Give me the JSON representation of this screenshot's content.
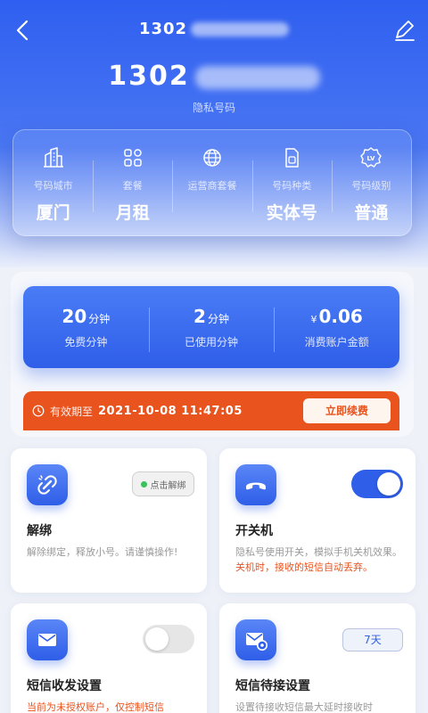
{
  "header": {
    "title_prefix": "1302",
    "number_prefix": "1302",
    "private_label": "隐私号码"
  },
  "info": [
    {
      "icon": "city-buildings-icon",
      "label": "号码城市",
      "value": "厦门"
    },
    {
      "icon": "grid-apps-icon",
      "label": "套餐",
      "value": "月租"
    },
    {
      "icon": "globe-icon",
      "label": "运营商套餐",
      "value": ""
    },
    {
      "icon": "sim-card-icon",
      "label": "号码种类",
      "value": "实体号"
    },
    {
      "icon": "level-badge-icon",
      "label": "号码级别",
      "value": "普通"
    }
  ],
  "usage": [
    {
      "value": "20",
      "unit": "分钟",
      "label": "免费分钟"
    },
    {
      "value": "2",
      "unit": "分钟",
      "label": "已使用分钟"
    },
    {
      "currency": "¥",
      "value": "0.06",
      "label": "消费账户金额"
    }
  ],
  "expire": {
    "label": "有效期至",
    "date": "2021-10-08 11:47:05",
    "renew_label": "立即续费"
  },
  "cards": {
    "unbind": {
      "title": "解绑",
      "desc": "解除绑定，释放小号。请谨慎操作!",
      "button": "点击解绑"
    },
    "power": {
      "title": "开关机",
      "desc": "隐私号使用开关，模拟手机关机效果。",
      "warn": "关机时，接收的短信自动丢弃。",
      "toggle_on": true
    },
    "sms": {
      "title": "短信收发设置",
      "warn": "当前为未授权账户，仅控制短信",
      "toggle_on": false
    },
    "pending": {
      "title": "短信待接设置",
      "desc": "设置待接收短信最大延时接收时",
      "button": "7天"
    }
  },
  "colors": {
    "primary": "#2f5ee8",
    "accent": "#e8531e",
    "success": "#37c25a"
  }
}
